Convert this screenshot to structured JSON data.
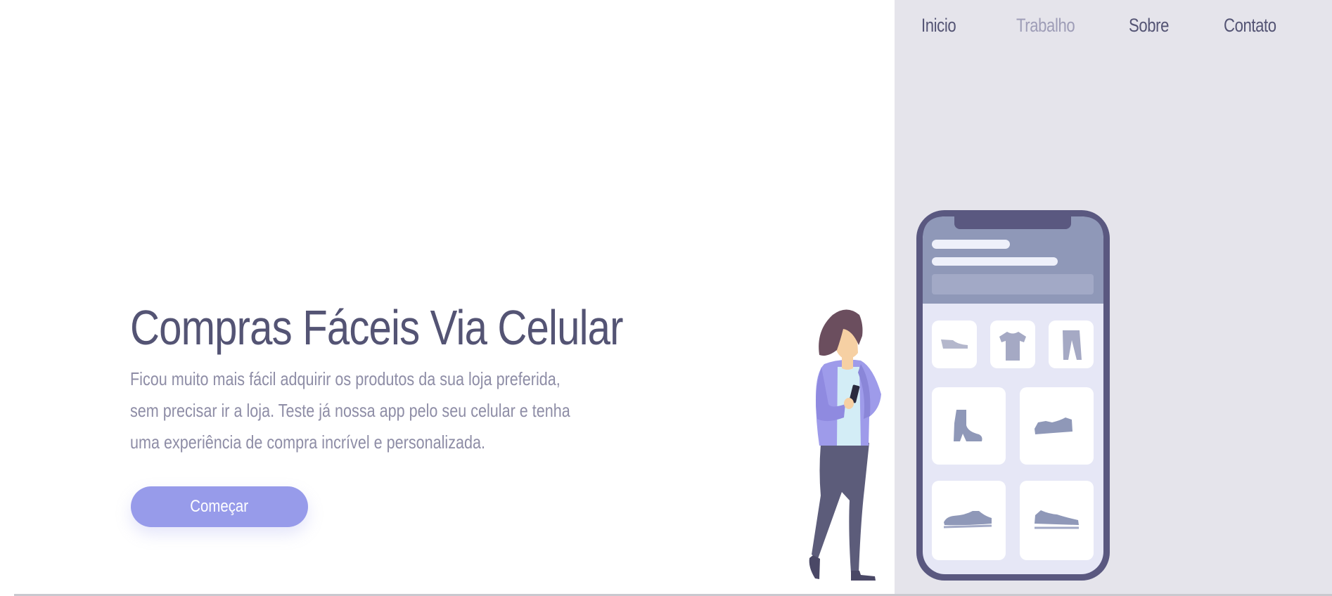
{
  "nav": {
    "items": [
      {
        "label": "Inicio",
        "active": false
      },
      {
        "label": "Trabalho",
        "active": true
      },
      {
        "label": "Sobre",
        "active": false
      },
      {
        "label": "Contato",
        "active": false
      }
    ]
  },
  "hero": {
    "title": "Compras Fáceis Via Celular",
    "description": "Ficou muito mais fácil adquirir os produtos da sua loja preferida, sem precisar ir a loja. Teste já nossa app pelo seu celular e tenha uma experiência de compra incrível e personalizada.",
    "cta_label": "Começar"
  },
  "colors": {
    "primary_text": "#545474",
    "muted_text": "#8e8da6",
    "accent": "#979bea",
    "panel_bg": "#e5e4eb",
    "phone_frame": "#5a5880"
  },
  "illustration": {
    "icons": [
      "flat-shoe-icon",
      "t-shirt-icon",
      "pants-icon",
      "boot-icon",
      "sneaker-icon",
      "sneaker-icon",
      "sneaker-icon"
    ]
  }
}
